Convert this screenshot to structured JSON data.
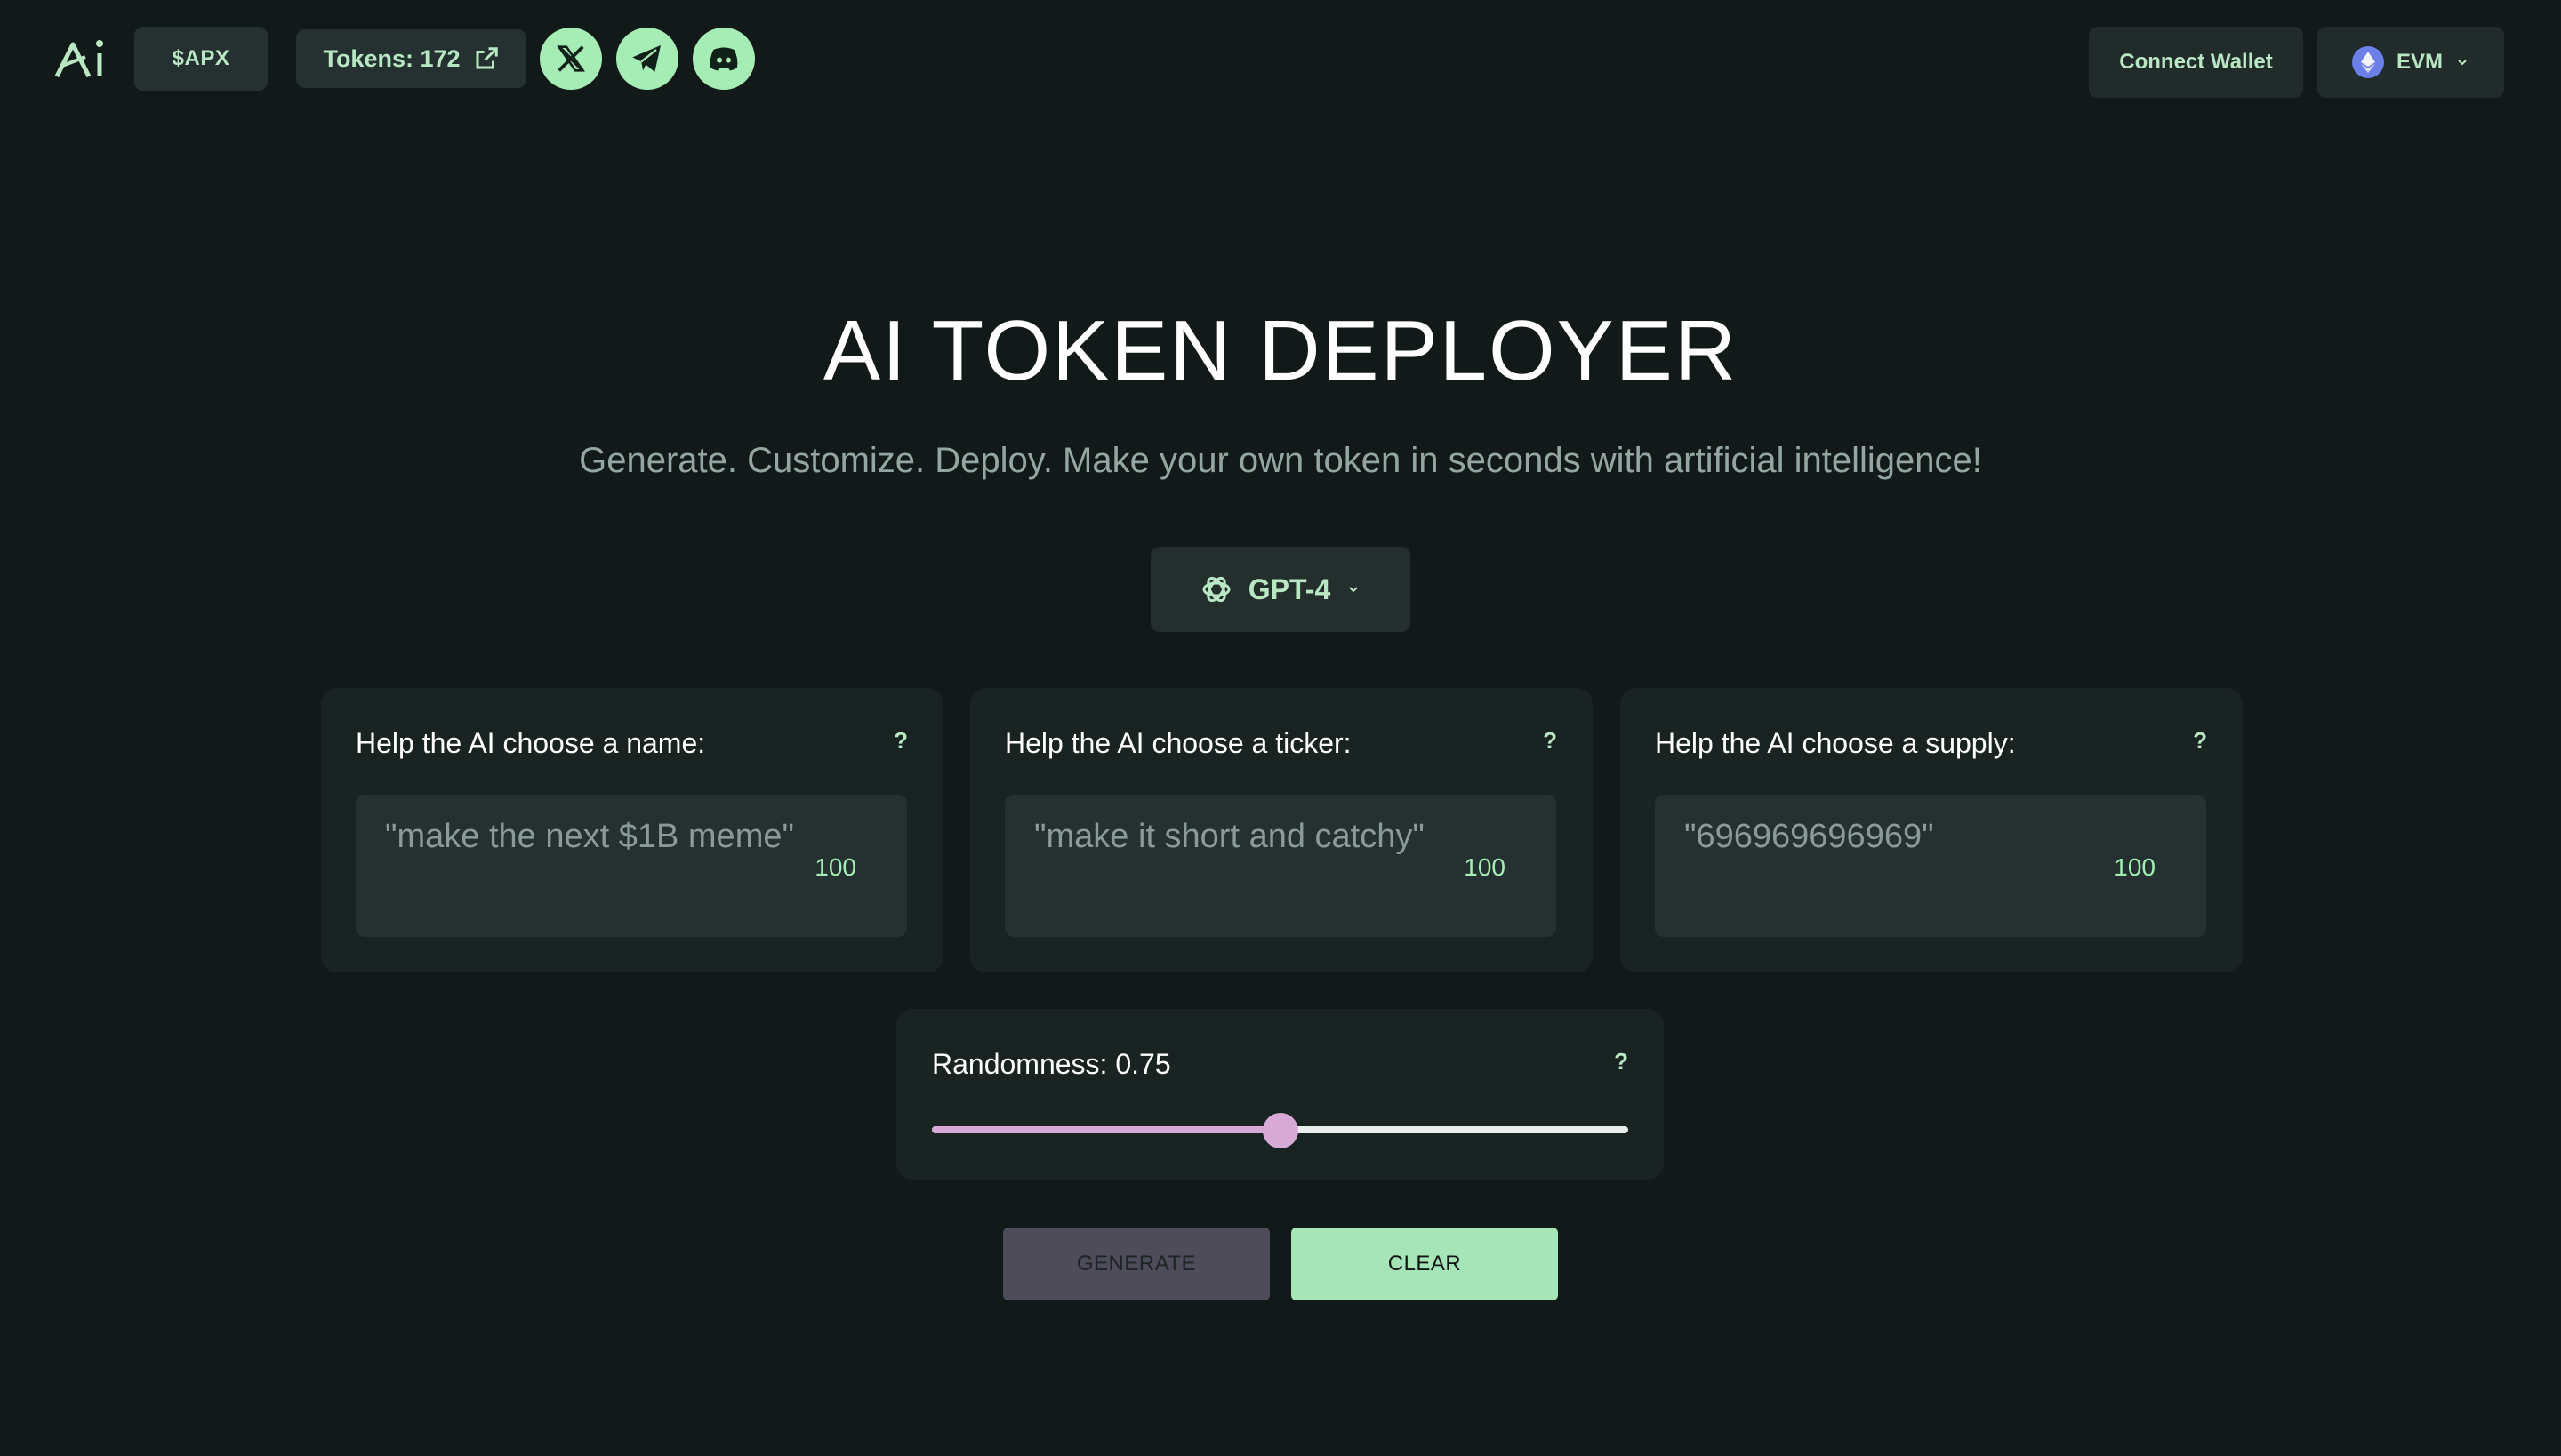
{
  "header": {
    "logo": "Ai",
    "ticker_label": "$APX",
    "tokens_label": "Tokens: 172",
    "socials": [
      {
        "icon": "x-icon"
      },
      {
        "icon": "telegram-icon"
      },
      {
        "icon": "discord-icon"
      }
    ],
    "connect_label": "Connect Wallet",
    "network_label": "EVM"
  },
  "hero": {
    "title": "AI TOKEN DEPLOYER",
    "subtitle": "Generate. Customize. Deploy. Make your own token in seconds with artificial intelligence!"
  },
  "model": {
    "selected": "GPT-4"
  },
  "cards": [
    {
      "label": "Help the AI choose a name:",
      "help": "?",
      "placeholder": "\"make the next $1B meme\"",
      "count": "100"
    },
    {
      "label": "Help the AI choose a ticker:",
      "help": "?",
      "placeholder": "\"make it short and catchy\"",
      "count": "100"
    },
    {
      "label": "Help the AI choose a supply:",
      "help": "?",
      "placeholder": "\"696969696969\"",
      "count": "100"
    }
  ],
  "randomness": {
    "label": "Randomness: 0.75",
    "help": "?",
    "value": 0.75,
    "fill_fraction": 0.5
  },
  "actions": {
    "generate_label": "GENERATE",
    "clear_label": "CLEAR"
  },
  "colors": {
    "background": "#121a19",
    "accent": "#a6ecb5",
    "slider": "#d7a9d5"
  }
}
